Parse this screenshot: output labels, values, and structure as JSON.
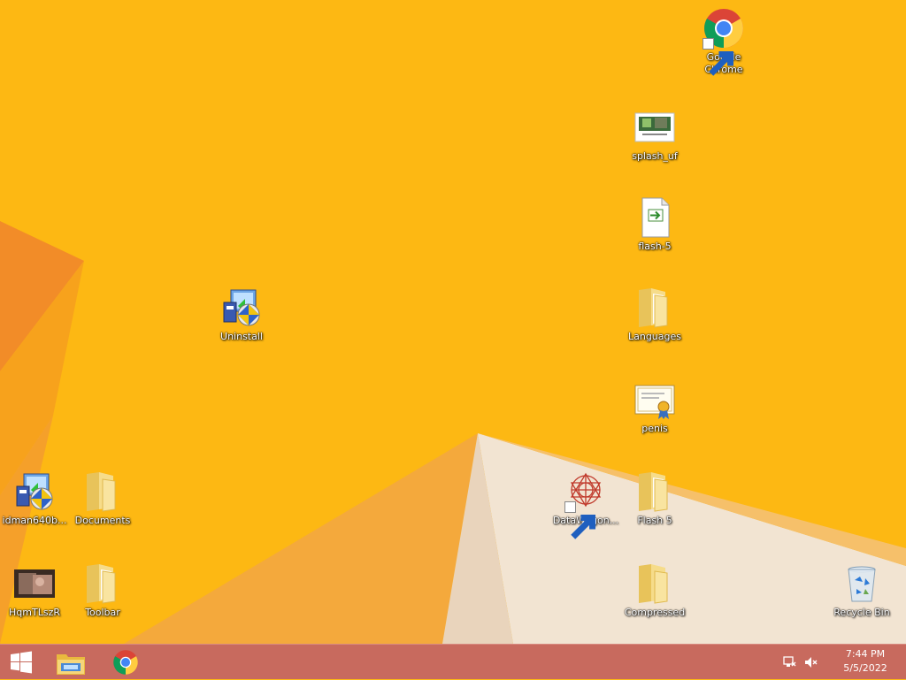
{
  "desktop": {
    "icons": {
      "chrome": {
        "label": "Google Chrome"
      },
      "splash": {
        "label": "splash_uf"
      },
      "flash5file": {
        "label": "flash-5"
      },
      "languages": {
        "label": "Languages"
      },
      "uninstall": {
        "label": "Uninstall"
      },
      "penis": {
        "label": "penis"
      },
      "idman": {
        "label": "idman640b..."
      },
      "documents": {
        "label": "Documents"
      },
      "datawagon": {
        "label": "DataWagon..."
      },
      "flash5folder": {
        "label": "Flash 5"
      },
      "hqm": {
        "label": "HqmTLszR"
      },
      "toolbar": {
        "label": "Toolbar"
      },
      "compressed": {
        "label": "Compressed"
      },
      "recycle": {
        "label": "Recycle Bin"
      }
    }
  },
  "taskbar": {
    "clock_time": "7:44 PM",
    "clock_date": "5/5/2022",
    "colors": {
      "bar": "#C86A5E",
      "wallpaper": "#FDB813"
    }
  }
}
